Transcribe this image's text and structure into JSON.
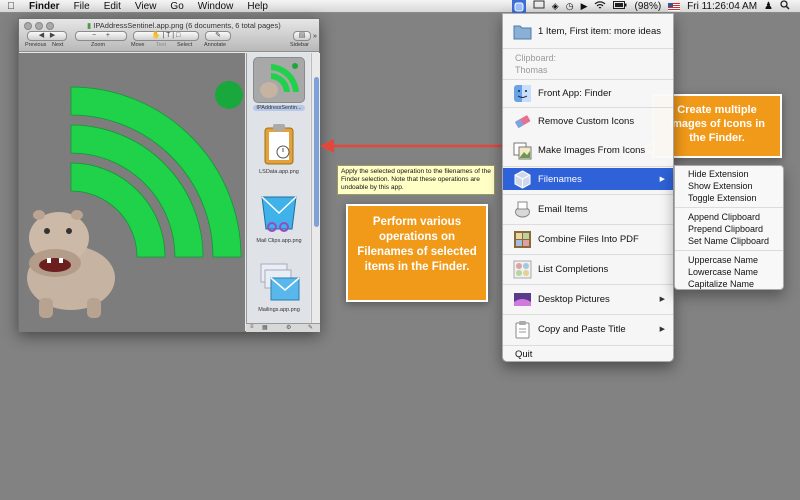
{
  "menubar": {
    "app_name": "Finder",
    "items": [
      "File",
      "Edit",
      "View",
      "Go",
      "Window",
      "Help"
    ],
    "battery": "(98%)",
    "clock": "Fri 11:26:04 AM"
  },
  "preview": {
    "title": "IPAddressSentinel.app.png (6 documents, 6 total pages)",
    "toolbar_labels": {
      "previous": "Previous",
      "next": "Next",
      "zoom": "Zoom",
      "move": "Move",
      "text": "Text",
      "select": "Select",
      "annotate": "Annotate",
      "sidebar": "Sidebar"
    },
    "thumbnails": [
      {
        "caption": "IPAddressSentin...",
        "selected": true
      },
      {
        "caption": "LSData.app.png",
        "selected": false
      },
      {
        "caption": "Mail Clips.app.png",
        "selected": false
      },
      {
        "caption": "Mailings.app.png",
        "selected": false
      }
    ]
  },
  "menu": {
    "item_first": "1 Item, First item: more ideas",
    "clipboard_label": "Clipboard:",
    "clipboard_value": "Thomas",
    "front_app": "Front App: Finder",
    "remove_icons": "Remove Custom Icons",
    "make_images": "Make Images From Icons",
    "filenames": "Filenames",
    "email_items": "Email Items",
    "combine_pdf": "Combine Files Into PDF",
    "list_completions": "List Completions",
    "desktop_pictures": "Desktop Pictures",
    "copy_paste_title": "Copy and Paste Title",
    "quit": "Quit"
  },
  "submenu": {
    "items": [
      "Hide Extension",
      "Show Extension",
      "Toggle Extension",
      "Append Clipboard",
      "Prepend Clipboard",
      "Set Name Clipboard",
      "Uppercase Name",
      "Lowercase Name",
      "Capitalize Name"
    ]
  },
  "callouts": {
    "icons": "Create multiple images of Icons in the Finder.",
    "filenames": "Perform various operations on Filenames of selected items in the Finder."
  },
  "tooltip": "Apply the selected operation to the filenames of the Finder selection. Note that these operations are undoable by this app.",
  "colors": {
    "menu_highlight": "#2f62d8",
    "callout": "#f19a1a",
    "arrow": "#e2473c",
    "tooltip_bg": "#ffffc6"
  }
}
